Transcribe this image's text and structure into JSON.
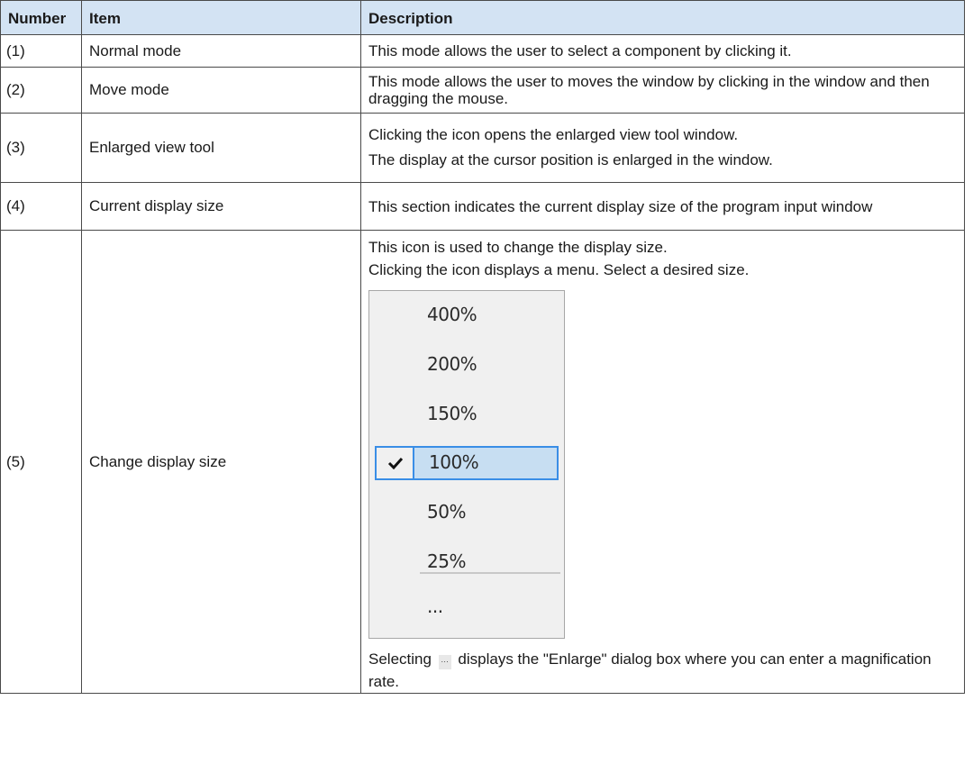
{
  "table": {
    "headers": {
      "number": "Number",
      "item": "Item",
      "description": "Description"
    },
    "rows": [
      {
        "number": "(1)",
        "item": "Normal mode",
        "description": [
          "This mode allows the user to select a component by clicking it."
        ]
      },
      {
        "number": "(2)",
        "item": "Move mode",
        "description": [
          "This mode allows the user to moves the window by clicking in the window and then dragging the mouse."
        ]
      },
      {
        "number": "(3)",
        "item": "Enlarged view tool",
        "description": [
          "Clicking the icon opens the enlarged view tool window.",
          "The display at the cursor position is enlarged in the window."
        ]
      },
      {
        "number": "(4)",
        "item": "Current display size",
        "description": [
          "This section indicates the current display size of the program input window"
        ]
      },
      {
        "number": "(5)",
        "item": "Change display size",
        "description": [
          "This icon is used to change the display size.",
          "Clicking the icon displays a menu. Select a desired size."
        ],
        "description_tail_before": "Selecting",
        "description_tail_after": "displays the \"Enlarge\" dialog box where you can enter a magnification rate."
      }
    ]
  },
  "zoom_menu": {
    "items": [
      "400%",
      "200%",
      "150%",
      "100%",
      "50%",
      "25%"
    ],
    "selected": "100%",
    "more": "...",
    "inline_icon": "…",
    "accent": "#3a8ee6",
    "highlight": "#c7def2",
    "header_bg": "#d3e3f3"
  }
}
